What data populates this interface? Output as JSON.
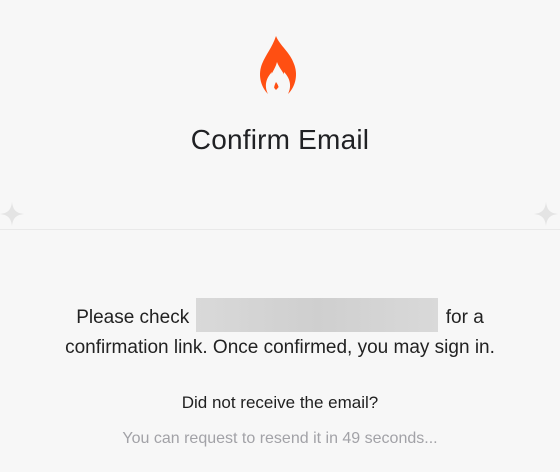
{
  "header": {
    "logo_icon": "flame-icon",
    "title": "Confirm Email",
    "accent_color": "#ff4f12"
  },
  "message": {
    "line1_before": "Please check",
    "line1_after": "for a",
    "line2": "confirmation link. Once confirmed, you may sign in."
  },
  "question": "Did not receive the email?",
  "resend_status": "You can request to resend it in 49 seconds..."
}
